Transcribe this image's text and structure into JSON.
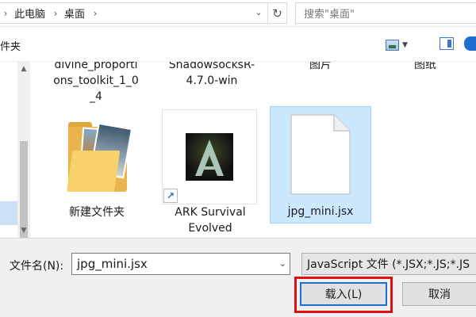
{
  "address_bar": {
    "breadcrumbs": [
      "此电脑",
      "桌面"
    ],
    "search_placeholder": "搜索\"桌面\""
  },
  "toolbar": {
    "new_folder_label": "件夹"
  },
  "files": [
    {
      "label_lines": [
        "divine_proporti",
        "ons_toolkit_1_0",
        "_4"
      ],
      "kind": "partial-top"
    },
    {
      "label_lines": [
        "ShadowsocksR-",
        "4.7.0-win"
      ],
      "kind": "partial-top"
    },
    {
      "label_lines": [
        "图片"
      ],
      "kind": "partial-top"
    },
    {
      "label_lines": [
        "图纸"
      ],
      "kind": "partial-top"
    },
    {
      "label_lines": [
        "新建文件夹"
      ],
      "kind": "folder",
      "icon": "folder-icon"
    },
    {
      "label_lines": [
        "ARK Survival",
        "Evolved"
      ],
      "kind": "shortcut",
      "icon": "ark-app-icon"
    },
    {
      "label_lines": [
        "jpg_mini.jsx"
      ],
      "kind": "document",
      "icon": "document-icon",
      "selected": true
    }
  ],
  "file_name": {
    "label": "文件名(N):",
    "value": "jpg_mini.jsx"
  },
  "file_type": {
    "selected": "JavaScript 文件 (*.JSX;*.JS;*.JS"
  },
  "buttons": {
    "load_label": "载入(L)",
    "cancel_label": "取消"
  },
  "colors": {
    "selection_fill": "#cce8ff",
    "primary_button_border": "#1f6fd0",
    "highlight_box": "#e01010"
  }
}
